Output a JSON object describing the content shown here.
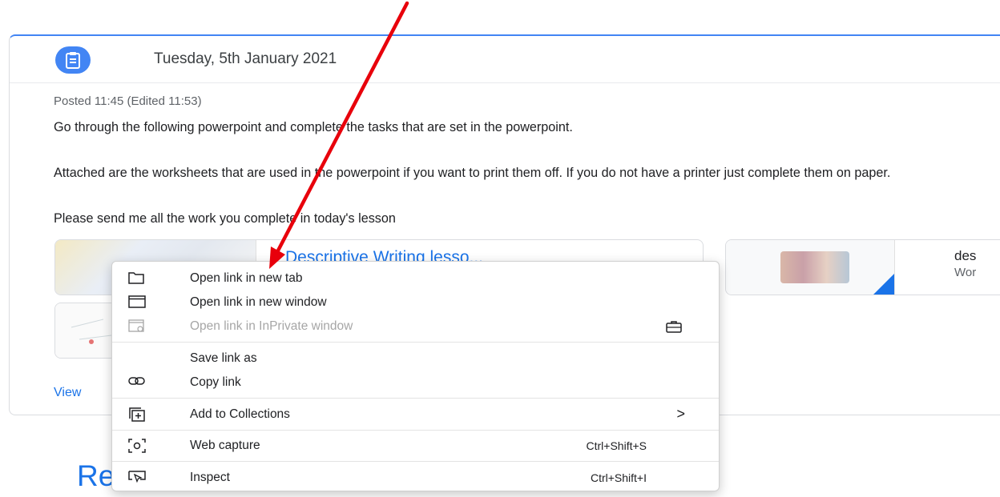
{
  "post": {
    "date": "Tuesday, 5th January 2021",
    "posted": "Posted 11:45 (Edited 11:53)",
    "para1": "Go through the following powerpoint and complete the tasks that are set in the powerpoint.",
    "para2": "Attached are the worksheets that are used in the powerpoint if you want to print them off. If you do not have a printer just complete them on paper.",
    "para3": "Please send me all the work you complete in today's lesson",
    "attachment1_title": "Descriptive Writing lesso...",
    "attachment2_title": "des",
    "attachment2_subtitle": "Wor",
    "view_link": "View"
  },
  "section_title": "Re",
  "context_menu": {
    "items": [
      {
        "label": "Open link in new tab",
        "icon": "new-tab-icon",
        "enabled": true
      },
      {
        "label": "Open link in new window",
        "icon": "new-window-icon",
        "enabled": true
      },
      {
        "label": "Open link in InPrivate window",
        "icon": "inprivate-icon",
        "enabled": false,
        "trailing_icon": "briefcase-icon"
      },
      {
        "label": "Save link as",
        "enabled": true
      },
      {
        "label": "Copy link",
        "icon": "link-icon",
        "enabled": true
      },
      {
        "label": "Add to Collections",
        "icon": "collections-icon",
        "enabled": true,
        "submenu": ">"
      },
      {
        "label": "Web capture",
        "icon": "web-capture-icon",
        "enabled": true,
        "shortcut": "Ctrl+Shift+S"
      },
      {
        "label": "Inspect",
        "icon": "inspect-icon",
        "enabled": true,
        "shortcut": "Ctrl+Shift+I"
      }
    ]
  },
  "colors": {
    "accent": "#1a73e8",
    "header_icon_bg": "#4285f4",
    "annotation_arrow": "#e8000b"
  }
}
